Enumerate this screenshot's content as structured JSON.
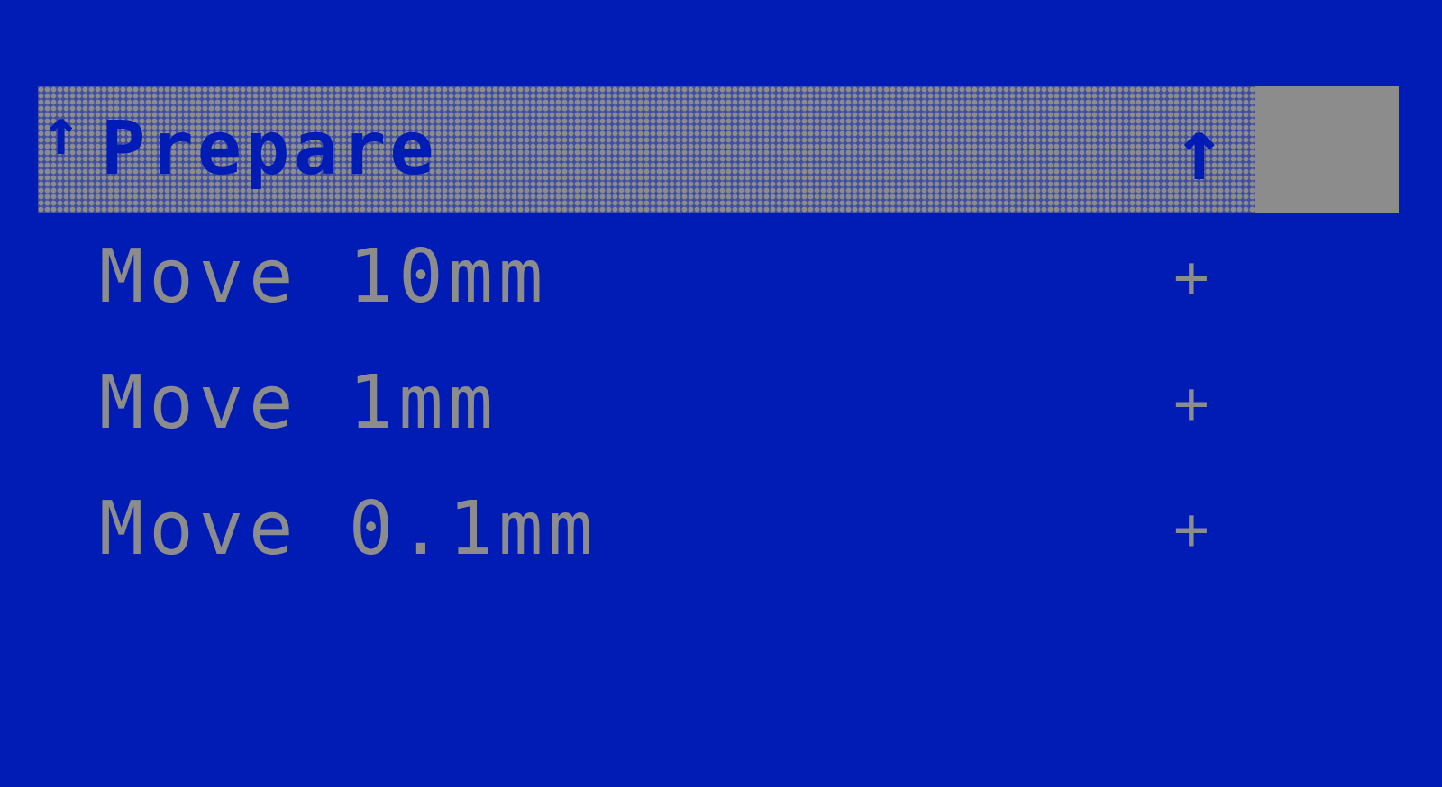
{
  "menu": {
    "header": {
      "label": "Prepare",
      "left_icon": "back-arrow-icon",
      "left_glyph": "↑",
      "right_icon": "up-arrow-icon",
      "right_glyph": "↑"
    },
    "items": [
      {
        "label": "Move 10mm",
        "icon": "plus-icon",
        "glyph": "+"
      },
      {
        "label": "Move 1mm",
        "icon": "plus-icon",
        "glyph": "+"
      },
      {
        "label": "Move 0.1mm",
        "icon": "plus-icon",
        "glyph": "+"
      }
    ]
  },
  "colors": {
    "background": "#001cb4",
    "foreground": "#8c8c8c"
  }
}
